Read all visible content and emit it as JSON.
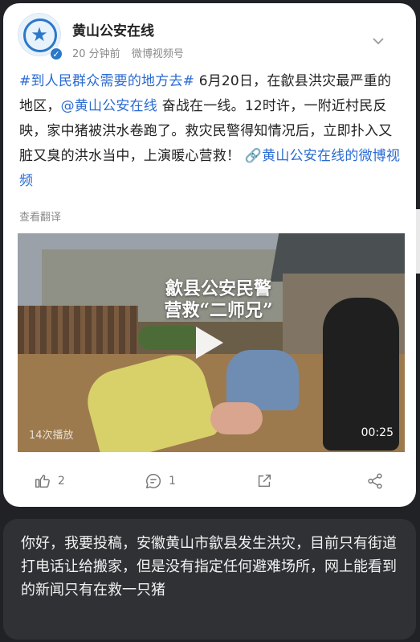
{
  "post": {
    "username": "黄山公安在线",
    "time": "20 分钟前",
    "source": "微博视频号",
    "hashtag": "#到人民群众需要的地方去#",
    "text_1": " 6月20日，在歙县洪灾最严重的地区，",
    "mention": "@黄山公安在线",
    "text_2": " 奋战在一线。12时许，一附近村民反映，家中猪被洪水卷跑了。救灾民警得知情况后，立即扑入又脏又臭的洪水当中，上演暖心营救！",
    "video_link": "🔗黄山公安在线的微博视频",
    "translate": "查看翻译"
  },
  "video": {
    "title_line1": "歙县公安民警",
    "title_line2": "营救“二师兄”",
    "plays": "14次播放",
    "duration": "00:25"
  },
  "actions": {
    "like_count": "2",
    "comment_count": "1"
  },
  "message": {
    "text": "你好，我要投稿，安徽黄山市歙县发生洪灾，目前只有街道打电话让给搬家，但是没有指定任何避难场所，网上能看到的新闻只有在救一只猪"
  },
  "colors": {
    "link": "#2a6bd3",
    "background": "#202225",
    "message_bubble": "#2f3134"
  }
}
